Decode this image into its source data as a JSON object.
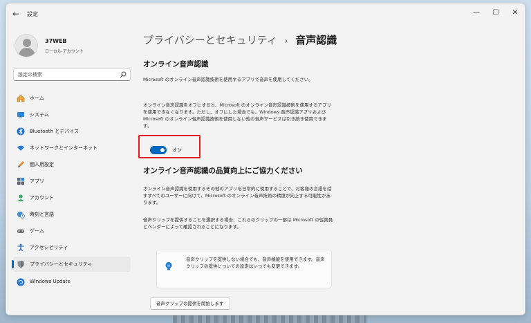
{
  "window": {
    "title": "設定",
    "back_icon": "arrow-left-icon",
    "minimize_icon": "minimize-icon",
    "maximize_icon": "maximize-icon",
    "close_icon": "close-icon"
  },
  "profile": {
    "name": "37WEB",
    "account_type": "ローカル アカウント"
  },
  "search": {
    "placeholder": "設定の検索"
  },
  "nav": {
    "items": [
      {
        "label": "ホーム",
        "icon": "home-icon"
      },
      {
        "label": "システム",
        "icon": "monitor-icon"
      },
      {
        "label": "Bluetooth とデバイス",
        "icon": "bluetooth-icon"
      },
      {
        "label": "ネットワークとインターネット",
        "icon": "wifi-icon"
      },
      {
        "label": "個人用設定",
        "icon": "pencil-icon"
      },
      {
        "label": "アプリ",
        "icon": "apps-icon"
      },
      {
        "label": "アカウント",
        "icon": "account-icon"
      },
      {
        "label": "時刻と言語",
        "icon": "globe-clock-icon"
      },
      {
        "label": "ゲーム",
        "icon": "gamepad-icon"
      },
      {
        "label": "アクセシビリティ",
        "icon": "accessibility-icon"
      },
      {
        "label": "プライバシーとセキュリティ",
        "icon": "shield-icon",
        "active": true
      },
      {
        "label": "Windows Update",
        "icon": "update-icon"
      }
    ]
  },
  "content": {
    "breadcrumb_parent": "プライバシーとセキュリティ",
    "breadcrumb_sep": "›",
    "breadcrumb_current": "音声認識",
    "section1_title": "オンライン音声認識",
    "section1_desc1": "Microsoft のオンライン音声認識技術を使用するアプリで音声を使用してください。",
    "section1_desc2": "オンライン音声認識をオフにすると、Microsoft のオンライン音声認識技術を使用するアプリを使用できなくなります。ただし、オフにした場合でも、Windows 音声認識アプリおよび Microsoft のオンライン音声認識技術を使用しない他の音声サービスは引き続き使用できます。",
    "toggle_label": "オン",
    "toggle_state": "on",
    "section2_title": "オンライン音声認識の品質向上にご協力ください",
    "section2_desc1": "オンライン音声認識を使用するその他のアプリを日常的に使用することで、お客様の言語を話すすべてのユーザーに向けて、Microsoft のオンライン音声技術の精度が向上する可能性があります。",
    "section2_desc2": "音声クリップを提供することを選択する場合、これらのクリップの一部は Microsoft の従業員とベンダーによって確認されることになります。",
    "info_text": "音声クリップを提供しない場合でも、音声機能を使用できます。音声クリップの提供についての設定はいつでも変更できます。",
    "start_button": "音声クリップの提供を開始します"
  },
  "colors": {
    "accent": "#0067c0",
    "highlight": "#e02020"
  }
}
